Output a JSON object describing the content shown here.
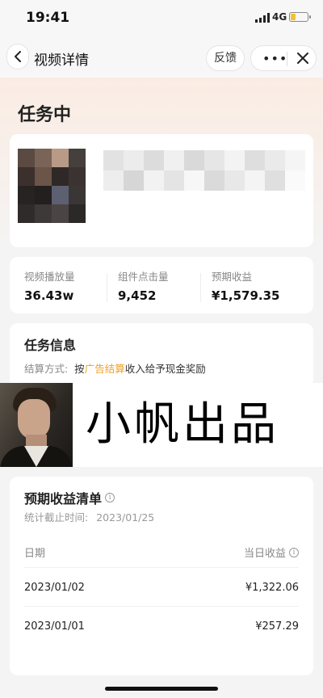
{
  "status_bar": {
    "time": "19:41",
    "network": "4G",
    "battery_level": 0.3
  },
  "nav": {
    "title": "视频详情",
    "feedback_label": "反馈",
    "more_label": "•••"
  },
  "task": {
    "status_title": "任务中"
  },
  "stats": [
    {
      "label": "视频播放量",
      "value": "36.43w"
    },
    {
      "label": "组件点击量",
      "value": "9,452"
    },
    {
      "label": "预期收益",
      "value": "¥1,579.35"
    }
  ],
  "task_info": {
    "title": "任务信息",
    "settlement_key": "结算方式:",
    "settlement_prefix": "按",
    "settlement_highlight": "广告结算",
    "settlement_suffix": "收入给予现金奖励"
  },
  "watermark": {
    "text": "小帆出品"
  },
  "earnings": {
    "title": "预期收益清单",
    "stat_label": "统计截止时间:",
    "stat_date": "2023/01/25",
    "col_date": "日期",
    "col_amount": "当日收益",
    "rows": [
      {
        "date": "2023/01/02",
        "amount": "¥1,322.06"
      },
      {
        "date": "2023/01/01",
        "amount": "¥257.29"
      }
    ]
  },
  "colors": {
    "highlight": "#f0a020",
    "hero_bg": "#fbece3",
    "page_bg": "#f4f4f4"
  }
}
